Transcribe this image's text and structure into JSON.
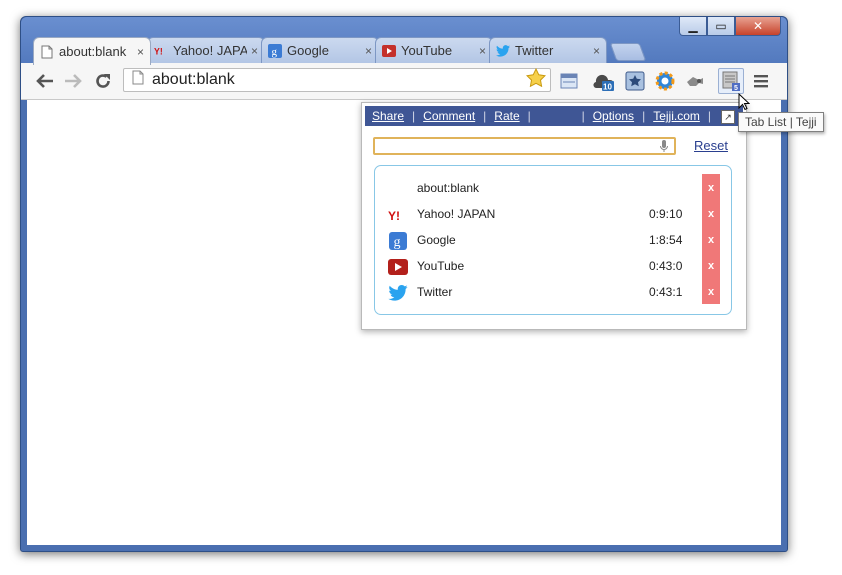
{
  "window": {
    "controls": {
      "minimize": "▁",
      "maximize": "▭",
      "close": "✕"
    }
  },
  "tabs": [
    {
      "title": "about:blank",
      "icon": "page-icon",
      "active": true,
      "close": "×"
    },
    {
      "title": "Yahoo! JAPAN",
      "icon": "yahoo-icon",
      "active": false,
      "close": "×"
    },
    {
      "title": "Google",
      "icon": "google-icon",
      "active": false,
      "close": "×"
    },
    {
      "title": "YouTube",
      "icon": "youtube-icon",
      "active": false,
      "close": "×"
    },
    {
      "title": "Twitter",
      "icon": "twitter-icon",
      "active": false,
      "close": "×"
    }
  ],
  "toolbar": {
    "url": "about:blank",
    "extension_badges": {
      "counter": "10",
      "tab_list": "5"
    }
  },
  "popup": {
    "header_links": {
      "share": "Share",
      "comment": "Comment",
      "rate": "Rate",
      "options": "Options",
      "site": "Tejji.com"
    },
    "separator": "|",
    "search": {
      "placeholder": "",
      "value": ""
    },
    "reset_label": "Reset",
    "close_label": "x",
    "items": [
      {
        "name": "about:blank",
        "time": "",
        "icon": "none"
      },
      {
        "name": "Yahoo! JAPAN",
        "time": "0:9:10",
        "icon": "yahoo-icon"
      },
      {
        "name": "Google",
        "time": "1:8:54",
        "icon": "google-icon"
      },
      {
        "name": "YouTube",
        "time": "0:43:0",
        "icon": "youtube-icon"
      },
      {
        "name": "Twitter",
        "time": "0:43:1",
        "icon": "twitter-icon"
      }
    ]
  },
  "tooltip": "Tab List | Tejji",
  "colors": {
    "frame": "#4a6fb0",
    "popup_header": "#3f5695",
    "close_column": "#f07878",
    "list_border": "#88c7e6",
    "search_border": "#e0b35a"
  }
}
